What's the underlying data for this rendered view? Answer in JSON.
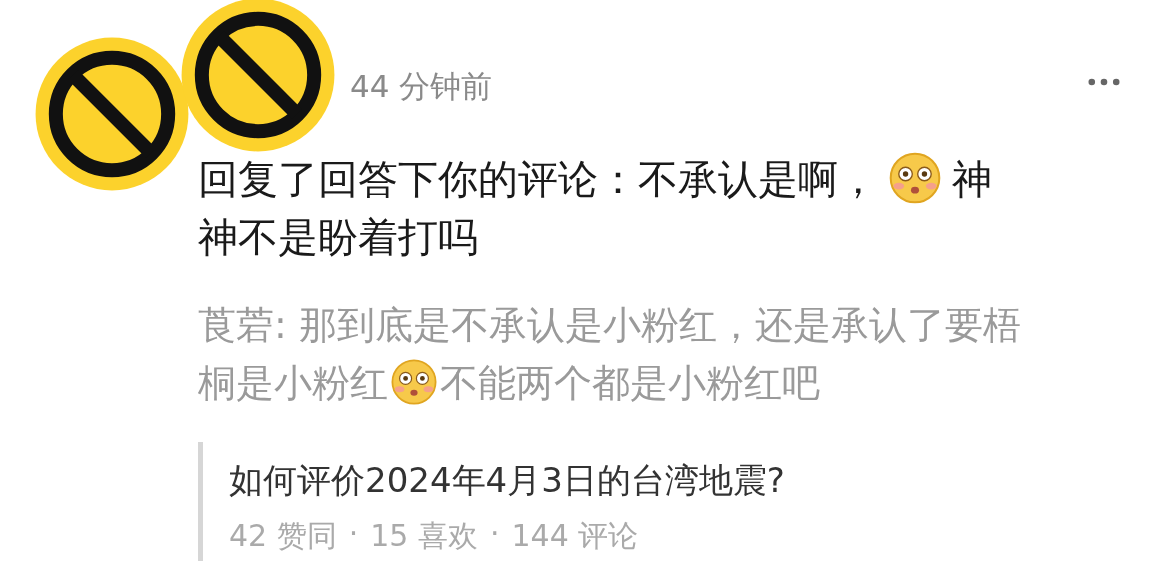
{
  "comment": {
    "time": "44 分钟前",
    "content": [
      {
        "kind": "text",
        "text": "回复了回答下你的评论：不承认是啊，"
      },
      {
        "kind": "emoji"
      },
      {
        "kind": "text",
        "text": "神"
      },
      {
        "kind": "break"
      },
      {
        "kind": "text",
        "text": "神不是盼着打吗"
      }
    ],
    "quoted": [
      {
        "kind": "text",
        "text": "莨菪: 那到底是不承认是小粉红，还是承认了要梧"
      },
      {
        "kind": "break"
      },
      {
        "kind": "text",
        "text": "桐是小粉红"
      },
      {
        "kind": "emoji"
      },
      {
        "kind": "text",
        "text": "不能两个都是小粉红吧"
      }
    ]
  },
  "question": {
    "title": "如何评价2024年4月3日的台湾地震?",
    "separator": "·",
    "stats": [
      "42 赞同",
      "15 喜欢",
      "144 评论"
    ]
  }
}
